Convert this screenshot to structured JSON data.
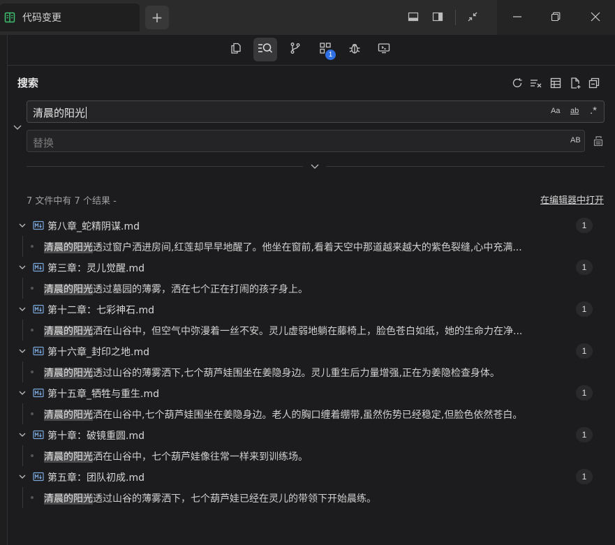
{
  "window": {
    "tab_title": "代码变更",
    "new_tab_label": "+"
  },
  "toolbar": {
    "items": [
      {
        "name": "explorer-icon",
        "active": false
      },
      {
        "name": "search-icon",
        "active": true
      },
      {
        "name": "source-control-icon",
        "active": false
      },
      {
        "name": "extensions-icon",
        "active": false,
        "badge": "1"
      },
      {
        "name": "debug-icon",
        "active": false
      },
      {
        "name": "remote-icon",
        "active": false
      }
    ]
  },
  "search": {
    "title": "搜索",
    "query": "清晨的阳光",
    "replace_placeholder": "替换",
    "match_case": "Aa",
    "whole_word": "ab",
    "regex": ".*",
    "preserve_case": "AB"
  },
  "results": {
    "summary": "7 文件中有 7 个结果 -",
    "open_in_editor": "在编辑器中打开",
    "files": [
      {
        "name": "第八章_蛇精阴谋.md",
        "count": "1",
        "match": "清晨的阳光",
        "rest": "透过窗户洒进房间,红莲却早早地醒了。他坐在窗前,看着天空中那道越来越大的紫色裂缝,心中充满..."
      },
      {
        "name": "第三章：灵儿觉醒.md",
        "count": "1",
        "match": "清晨的阳光",
        "rest": "透过墓园的薄雾，洒在七个正在打闹的孩子身上。"
      },
      {
        "name": "第十二章：七彩神石.md",
        "count": "1",
        "match": "清晨的阳光",
        "rest": "洒在山谷中，但空气中弥漫着一丝不安。灵儿虚弱地躺在藤椅上，脸色苍白如纸，她的生命力在净..."
      },
      {
        "name": "第十六章_封印之地.md",
        "count": "1",
        "match": "清晨的阳光",
        "rest": "透过山谷的薄雾洒下,七个葫芦娃围坐在姜隐身边。灵儿重生后力量增强,正在为姜隐检查身体。"
      },
      {
        "name": "第十五章_牺牲与重生.md",
        "count": "1",
        "match": "清晨的阳光",
        "rest": "洒在山谷中,七个葫芦娃围坐在姜隐身边。老人的胸口缠着绷带,虽然伤势已经稳定,但脸色依然苍白。"
      },
      {
        "name": "第十章：破镜重圆.md",
        "count": "1",
        "match": "清晨的阳光",
        "rest": "洒在山谷中，七个葫芦娃像往常一样来到训练场。"
      },
      {
        "name": "第五章：团队初成.md",
        "count": "1",
        "match": "清晨的阳光",
        "rest": "透过山谷的薄雾洒下，七个葫芦娃已经在灵儿的带领下开始晨练。"
      }
    ]
  }
}
